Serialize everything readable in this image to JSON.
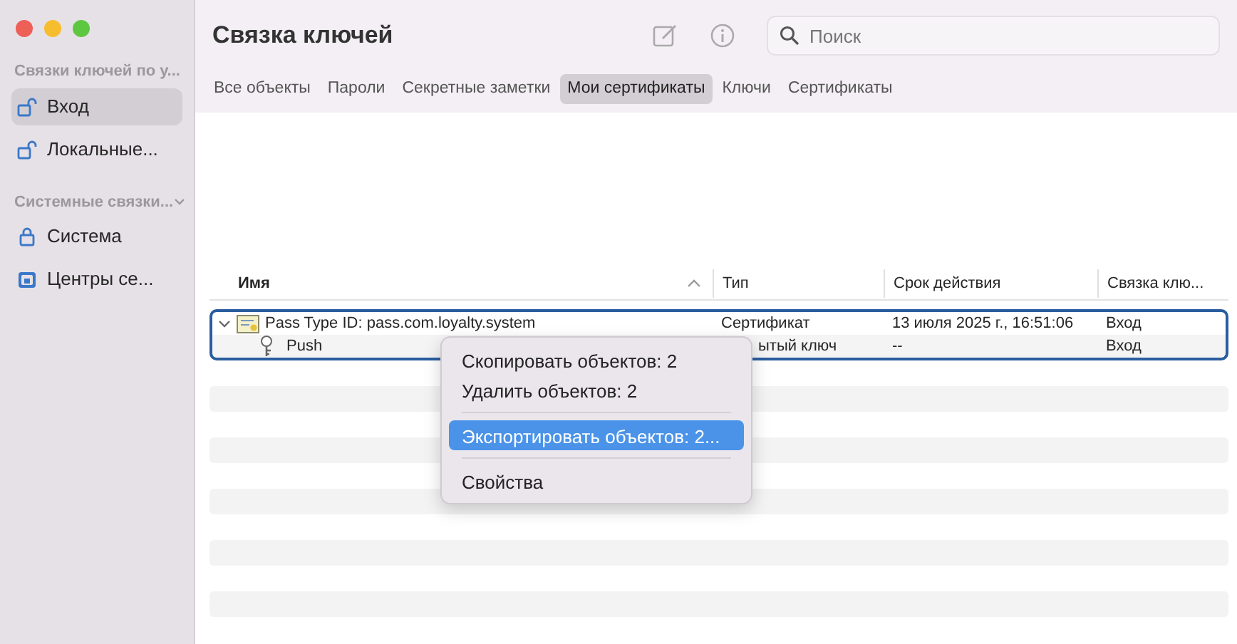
{
  "window": {
    "title": "Связка ключей"
  },
  "sidebar": {
    "sections": [
      {
        "heading": "Связки ключей по у...",
        "items": [
          {
            "label": "Вход",
            "kind": "unlocked",
            "selected": true
          },
          {
            "label": "Локальные...",
            "kind": "unlocked",
            "selected": false
          }
        ]
      },
      {
        "heading": "Системные связки...",
        "items": [
          {
            "label": "Система",
            "kind": "locked",
            "selected": false
          },
          {
            "label": "Центры се...",
            "kind": "vault",
            "selected": false
          }
        ]
      }
    ]
  },
  "search": {
    "placeholder": "Поиск"
  },
  "tabs": [
    {
      "label": "Все объекты",
      "selected": false
    },
    {
      "label": "Пароли",
      "selected": false
    },
    {
      "label": "Секретные заметки",
      "selected": false
    },
    {
      "label": "Мои сертификаты",
      "selected": true
    },
    {
      "label": "Ключи",
      "selected": false
    },
    {
      "label": "Сертификаты",
      "selected": false
    }
  ],
  "table": {
    "columns": [
      "Имя",
      "Тип",
      "Срок действия",
      "Связка клю..."
    ],
    "rows": [
      {
        "kind": "certificate",
        "expanded": true,
        "selected": true,
        "cells": [
          "Pass Type ID: pass.com.loyalty.system",
          "Сертификат",
          "13 июля 2025 г., 16:51:06",
          "Вход"
        ]
      },
      {
        "kind": "key",
        "selected": true,
        "cells": [
          "Push",
          "ытый ключ",
          "--",
          "Вход"
        ]
      }
    ]
  },
  "context_menu": {
    "groups": [
      [
        {
          "label": "Скопировать объектов: 2",
          "selected": false
        },
        {
          "label": "Удалить объектов: 2",
          "selected": false
        }
      ],
      [
        {
          "label": "Экспортировать объектов: 2...",
          "selected": true
        }
      ],
      [
        {
          "label": "Свойства",
          "selected": false
        }
      ]
    ]
  }
}
